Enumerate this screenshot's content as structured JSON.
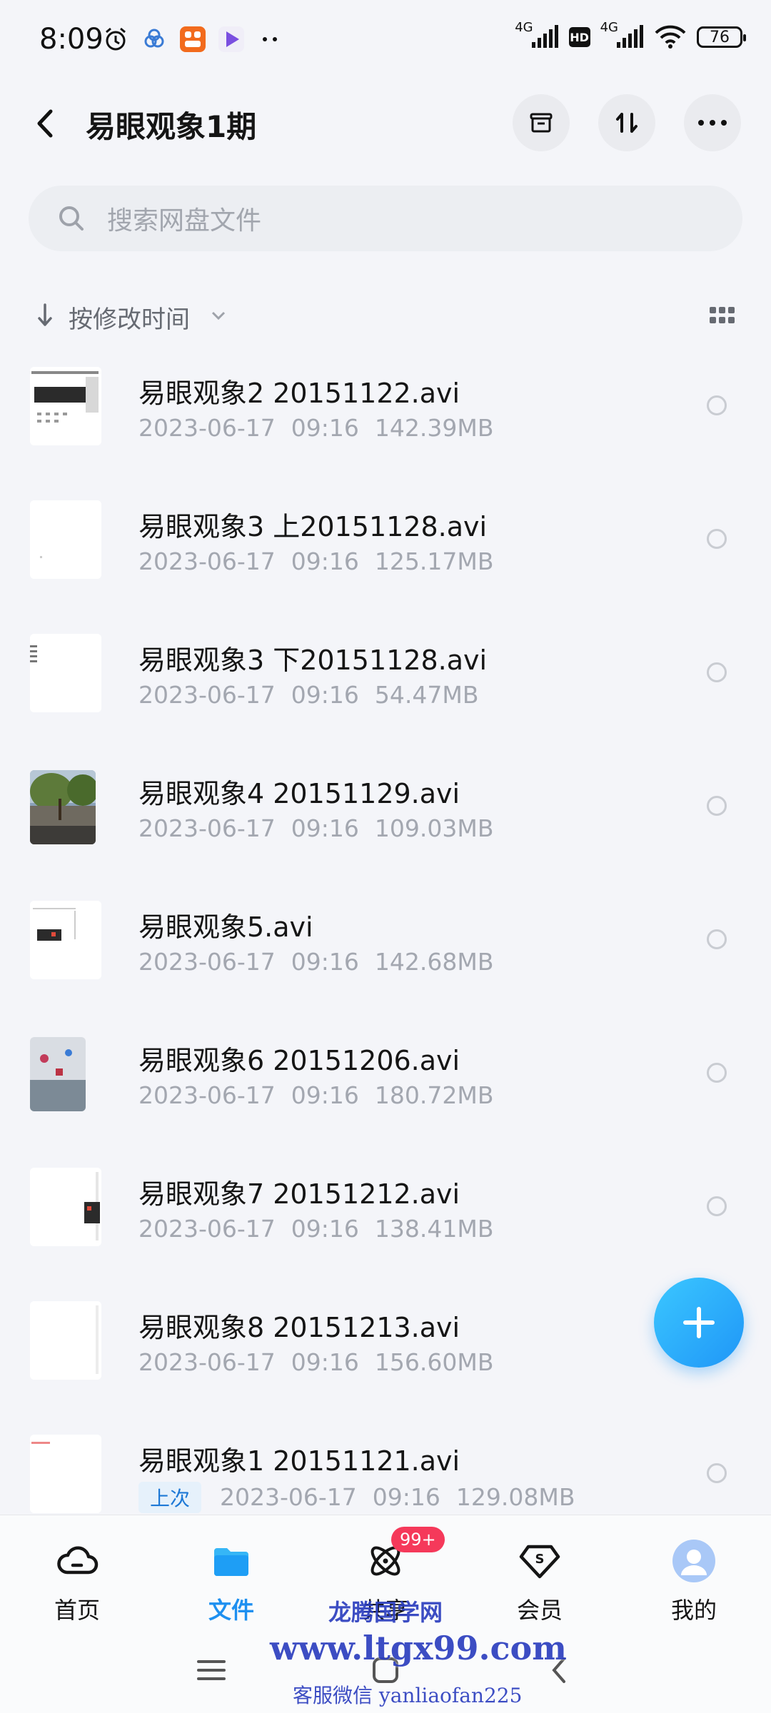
{
  "status_bar": {
    "time": "8:09",
    "net1": "4G",
    "hd": "HD",
    "net2": "4G",
    "battery": "76",
    "icons": [
      "alarm-icon",
      "app-icon-cloud",
      "app-icon-orange",
      "app-icon-play",
      "more-dots-icon",
      "signal-icon",
      "wifi-icon"
    ]
  },
  "header": {
    "title": "易眼观象1期",
    "actions": [
      "archive-icon",
      "transfer-icon",
      "more-icon"
    ]
  },
  "search": {
    "placeholder": "搜索网盘文件"
  },
  "sort": {
    "label": "按修改时间"
  },
  "files": [
    {
      "name": "易眼观象2 20151122.avi",
      "date": "2023-06-17",
      "time": "09:16",
      "size": "142.39MB",
      "tag": ""
    },
    {
      "name": "易眼观象3 上20151128.avi",
      "date": "2023-06-17",
      "time": "09:16",
      "size": "125.17MB",
      "tag": ""
    },
    {
      "name": "易眼观象3 下20151128.avi",
      "date": "2023-06-17",
      "time": "09:16",
      "size": "54.47MB",
      "tag": ""
    },
    {
      "name": "易眼观象4 20151129.avi",
      "date": "2023-06-17",
      "time": "09:16",
      "size": "109.03MB",
      "tag": ""
    },
    {
      "name": "易眼观象5.avi",
      "date": "2023-06-17",
      "time": "09:16",
      "size": "142.68MB",
      "tag": ""
    },
    {
      "name": "易眼观象6 20151206.avi",
      "date": "2023-06-17",
      "time": "09:16",
      "size": "180.72MB",
      "tag": ""
    },
    {
      "name": "易眼观象7 20151212.avi",
      "date": "2023-06-17",
      "time": "09:16",
      "size": "138.41MB",
      "tag": ""
    },
    {
      "name": "易眼观象8 20151213.avi",
      "date": "2023-06-17",
      "time": "09:16",
      "size": "156.60MB",
      "tag": ""
    },
    {
      "name": "易眼观象1 20151121.avi",
      "date": "2023-06-17",
      "time": "09:16",
      "size": "129.08MB",
      "tag": "上次"
    }
  ],
  "bottom_nav": [
    {
      "label": "首页",
      "icon": "cloud-icon",
      "active": false
    },
    {
      "label": "文件",
      "icon": "folder-icon",
      "active": true
    },
    {
      "label": "共享",
      "icon": "atom-icon",
      "active": false,
      "badge": "99+"
    },
    {
      "label": "会员",
      "icon": "vip-icon",
      "active": false
    },
    {
      "label": "我的",
      "icon": "avatar",
      "active": false
    }
  ],
  "watermark": {
    "line1": "龙腾国学网",
    "line2": "www.ltgx99.com",
    "line3": "客服微信 yanliaofan225"
  },
  "colors": {
    "accent": "#1e90f0",
    "badge": "#f5395a",
    "fab": "#2aabfb"
  }
}
